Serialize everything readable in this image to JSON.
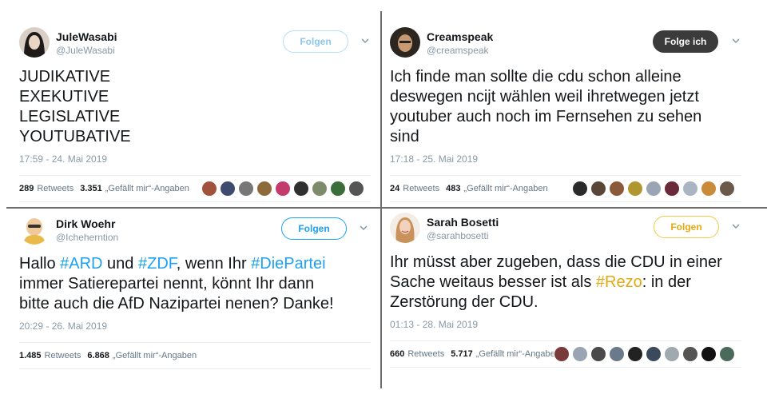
{
  "tweets": [
    {
      "display_name": "JuleWasabi",
      "handle": "@JuleWasabi",
      "follow_label": "Folgen",
      "lines": [
        "JUDIKATIVE",
        "EXEKUTIVE",
        "LEGISLATIVE",
        "YOUTUBATIVE"
      ],
      "timestamp": "17:59 - 24. Mai 2019",
      "retweets_count": "289",
      "retweets_label": "Retweets",
      "likes_count": "3.351",
      "likes_label": "„Gefällt mir“-Angaben",
      "liker_colors": [
        "#a0523a",
        "#3e4a6e",
        "#777777",
        "#8d6a3a",
        "#c23b6a",
        "#2f2f2f",
        "#7d8b6a",
        "#3b6d3b",
        "#555555"
      ]
    },
    {
      "display_name": "Creamspeak",
      "handle": "@creamspeak",
      "follow_label": "Folge ich",
      "lines": [
        "Ich finde man sollte die cdu schon alleine",
        "deswegen ncijt wählen weil ihretwegen jetzt",
        "youtuber auch noch im Fernsehen zu sehen",
        "sind"
      ],
      "timestamp": "17:18 - 25. Mai 2019",
      "retweets_count": "24",
      "retweets_label": "Retweets",
      "likes_count": "483",
      "likes_label": "„Gefällt mir“-Angaben",
      "liker_colors": [
        "#2a2a2a",
        "#5a4636",
        "#8a5a3a",
        "#b0962e",
        "#9aa4b2",
        "#6a2a3a",
        "#aab4c2",
        "#c98a3a",
        "#6b5a4a"
      ]
    },
    {
      "display_name": "Dirk Woehr",
      "handle": "@Icheherntion",
      "follow_label": "Folgen",
      "text_parts": [
        {
          "t": "Hallo ",
          "tag": false
        },
        {
          "t": "#ARD",
          "tag": true
        },
        {
          "t": " und ",
          "tag": false
        },
        {
          "t": "#ZDF",
          "tag": true
        },
        {
          "t": ", wenn Ihr ",
          "tag": false
        },
        {
          "t": "#DiePartei",
          "tag": true
        }
      ],
      "line2": "immer Satierepartei nennt, könnt Ihr dann",
      "line3": "bitte auch die AfD Nazipartei nenen? Danke!",
      "timestamp": "20:29 - 26. Mai 2019",
      "retweets_count": "1.485",
      "retweets_label": "Retweets",
      "likes_count": "6.868",
      "likes_label": "„Gefällt mir“-Angaben"
    },
    {
      "display_name": "Sarah Bosetti",
      "handle": "@sarahbosetti",
      "follow_label": "Folgen",
      "line1": "Ihr müsst aber zugeben, dass die CDU in einer",
      "line2_pre": "Sache weitaus besser ist als ",
      "line2_tag": "#Rezo",
      "line2_post": ": in der",
      "line3": "Zerstörung der CDU.",
      "timestamp": "01:13 - 28. Mai 2019",
      "retweets_count": "660",
      "retweets_label": "Retweets",
      "likes_count": "5.717",
      "likes_label": "„Gefällt mir“-Angaben",
      "liker_colors": [
        "#7a3a3a",
        "#9aa4b2",
        "#4a4a4a",
        "#6a7a8a",
        "#222222",
        "#3a4a5a",
        "#a0a8b0",
        "#555555",
        "#111111",
        "#4a6a5a"
      ]
    }
  ],
  "colors": {
    "link_blue": "#1da1f2",
    "hashtag_yellow": "#e5a910",
    "muted_gray": "#8899a6"
  }
}
